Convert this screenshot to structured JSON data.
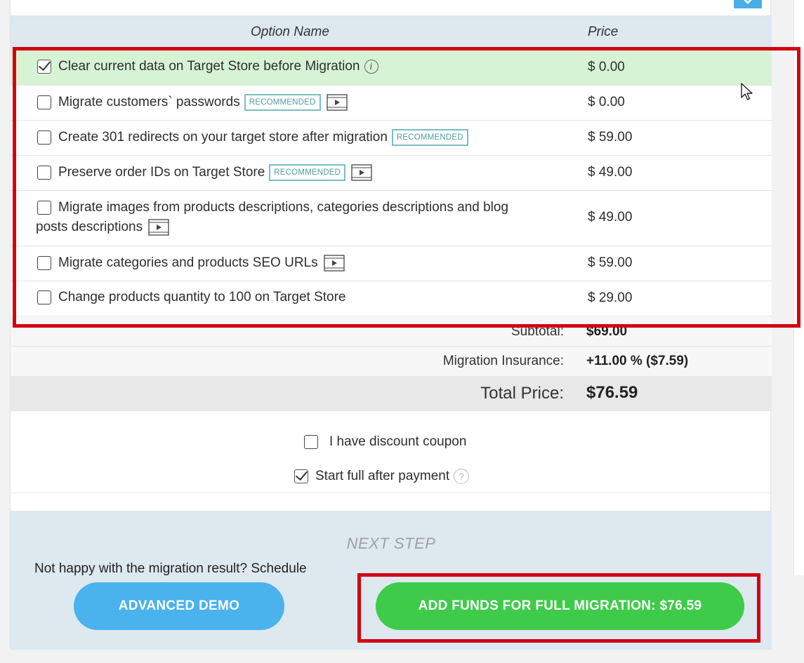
{
  "header": {
    "col_option": "Option Name",
    "col_price": "Price"
  },
  "options": [
    {
      "label": "Clear current data on Target Store before Migration",
      "price": "$ 0.00",
      "checked": true,
      "recommended": false,
      "video": false,
      "info": true
    },
    {
      "label": "Migrate customers` passwords",
      "price": "$ 0.00",
      "checked": false,
      "recommended": true,
      "video": true,
      "info": false
    },
    {
      "label": "Create 301 redirects on your target store after migration",
      "price": "$ 59.00",
      "checked": false,
      "recommended": true,
      "video": false,
      "info": false
    },
    {
      "label": "Preserve order IDs on Target Store",
      "price": "$ 49.00",
      "checked": false,
      "recommended": true,
      "video": true,
      "info": false
    },
    {
      "label_line1": "Migrate images from products descriptions, categories descriptions and blog",
      "label_line2": "posts descriptions",
      "price": "$ 49.00",
      "checked": false,
      "recommended": false,
      "video": true,
      "info": false
    },
    {
      "label": "Migrate categories and products SEO URLs",
      "price": "$ 59.00",
      "checked": false,
      "recommended": false,
      "video": true,
      "info": false
    },
    {
      "label": "Change products quantity to 100 on Target Store",
      "price": "$ 29.00",
      "checked": false,
      "recommended": false,
      "video": false,
      "info": false
    }
  ],
  "badge_text": "RECOMMENDED",
  "info_glyph": "i",
  "help_glyph": "?",
  "summary": {
    "subtotal_label": "Subtotal:",
    "subtotal_value": "$69.00",
    "insurance_label": "Migration Insurance:",
    "insurance_value": "+11.00 % ($7.59)",
    "total_label": "Total Price:",
    "total_value": "$76.59"
  },
  "coupon": {
    "label": "I have discount coupon",
    "checked": false
  },
  "start_full": {
    "label": "Start full after payment",
    "checked": true
  },
  "next_step": {
    "title": "NEXT STEP",
    "schedule_text": "Not happy with the migration result? Schedule",
    "demo_button": "ADVANCED DEMO",
    "add_funds_button": "ADD FUNDS FOR FULL MIGRATION: $76.59"
  },
  "icons": {
    "close": "close-icon",
    "video": "video-icon",
    "info": "info-icon",
    "help": "help-icon",
    "cursor": "mouse-cursor-icon"
  },
  "colors": {
    "header_bg": "#dde8ef",
    "selected_row": "#d7f3d6",
    "badge": "#79bec2",
    "demo_button": "#4ab2ec",
    "add_funds_button": "#3fcb4a",
    "highlight": "#d40011"
  }
}
